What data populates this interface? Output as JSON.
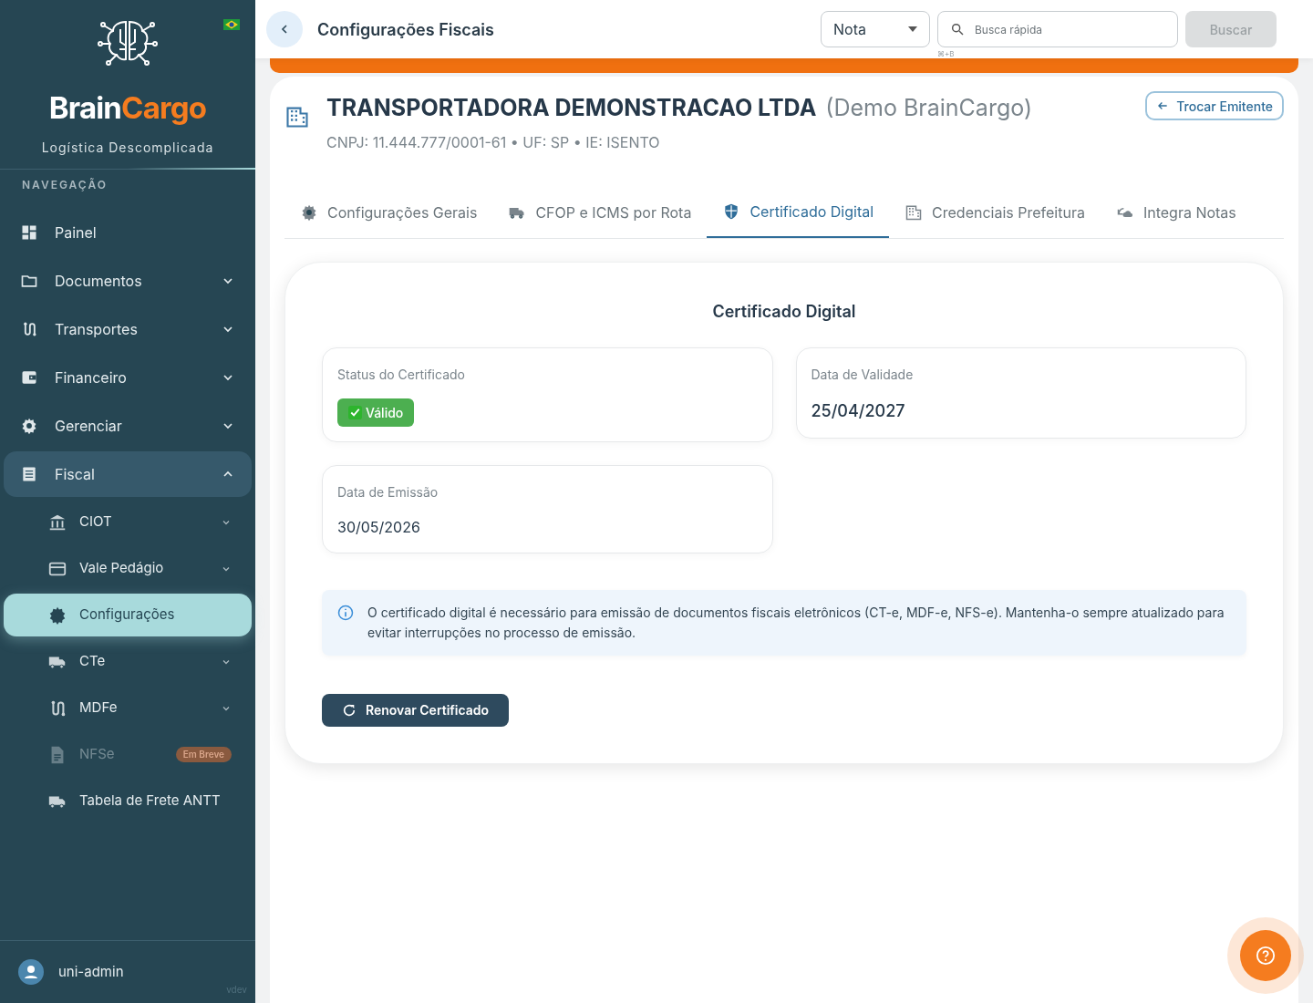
{
  "sidebar": {
    "brand": {
      "part_1": "Brain",
      "part_2": "Cargo",
      "tagline": "Logística Descomplicada"
    },
    "section_label": "NAVEGAÇÃO",
    "items": [
      {
        "label": "Painel",
        "selected": false
      },
      {
        "label": "Documentos",
        "selected": false,
        "expanded": false
      },
      {
        "label": "Transportes",
        "selected": false,
        "expanded": false
      },
      {
        "label": "Financeiro",
        "selected": false,
        "expanded": false
      },
      {
        "label": "Gerenciar",
        "selected": false,
        "expanded": false
      },
      {
        "label": "Fiscal",
        "selected": false,
        "expanded": true,
        "children": [
          {
            "label": "CIOT",
            "selected": false,
            "disabled": false,
            "expanded": false
          },
          {
            "label": "Vale Pedágio",
            "selected": false,
            "disabled": false,
            "expanded": false
          },
          {
            "label": "Configurações",
            "selected": true,
            "disabled": false
          },
          {
            "label": "CTe",
            "selected": false,
            "disabled": false,
            "expanded": false
          },
          {
            "label": "MDFe",
            "selected": false,
            "disabled": false,
            "expanded": false
          },
          {
            "label": "NFSe",
            "selected": false,
            "disabled": true,
            "badge": "Em Breve"
          },
          {
            "label": "Tabela de Frete ANTT",
            "selected": false,
            "disabled": false
          }
        ]
      }
    ],
    "user": {
      "name": "uni-admin",
      "version": "vdev"
    }
  },
  "header": {
    "title": "Configurações Fiscais",
    "type_select": "Nota",
    "search": {
      "placeholder": "Busca rápida",
      "shortcut": "⌘+B"
    },
    "search_button": "Buscar"
  },
  "company": {
    "name": "TRANSPORTADORA DEMONSTRACAO LTDA",
    "alias": "(Demo BrainCargo)",
    "details": "CNPJ: 11.444.777/0001-61 • UF: SP • IE: ISENTO",
    "switch_button": "Trocar Emitente"
  },
  "tabs": [
    {
      "label": "Configurações Gerais",
      "selected": false
    },
    {
      "label": "CFOP e ICMS por Rota",
      "selected": false
    },
    {
      "label": "Certificado Digital",
      "selected": true
    },
    {
      "label": "Credenciais Prefeitura",
      "selected": false
    },
    {
      "label": "Integra Notas",
      "selected": false
    }
  ],
  "panel": {
    "title": "Certificado Digital",
    "fields": [
      {
        "kind": "badge",
        "label": "Status do Certificado",
        "value": "Válido",
        "valid": true
      },
      {
        "kind": "text",
        "label": "Data de Validade",
        "value": "25/04/2027",
        "emphasis": true
      },
      {
        "kind": "text",
        "label": "Data de Emissão",
        "value": "30/05/2026",
        "emphasis": false
      }
    ],
    "info": "O certificado digital é necessário para emissão de documentos fiscais eletrônicos (CT-e, MDF-e, NFS-e). Mantenha-o sempre atualizado para evitar interrupções no processo de emissão.",
    "renew_button": "Renovar Certificado"
  }
}
